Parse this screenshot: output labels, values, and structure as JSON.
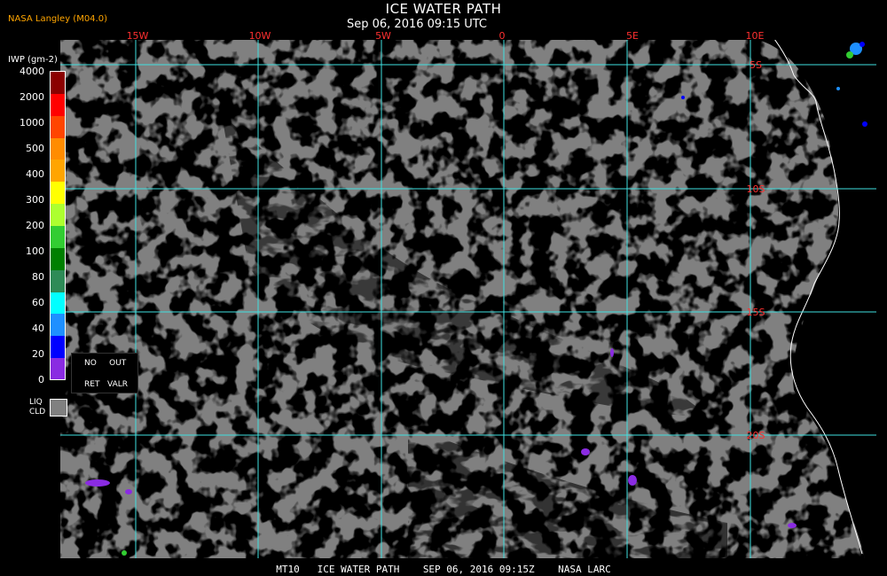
{
  "header": {
    "title": "ICE WATER PATH",
    "subtitle": "Sep 06, 2016 09:15 UTC",
    "credit": "NASA Langley (M04.0)"
  },
  "legend": {
    "label": "IWP (gm-2)",
    "ticks": [
      "4000",
      "2000",
      "1000",
      "500",
      "400",
      "300",
      "200",
      "100",
      "80",
      "60",
      "40",
      "20",
      "0"
    ],
    "colors": [
      "#8b0000",
      "#ff0000",
      "#ff4500",
      "#ff8c00",
      "#ffa500",
      "#ffff00",
      "#adff2f",
      "#32cd32",
      "#008000",
      "#2e8b57",
      "#00ffff",
      "#1e90ff",
      "#0000ff",
      "#8a2be2"
    ],
    "no_out": "NO     OUT",
    "ret_valr": "RET   VALR",
    "liq_cld": [
      "LIQ",
      "CLD"
    ],
    "liq_color": "#808080"
  },
  "map": {
    "lon_labels": [
      "15W",
      "10W",
      "5W",
      "0",
      "5E",
      "10E"
    ],
    "lat_labels": [
      "5S",
      "10S",
      "15S",
      "20S"
    ],
    "grid_color": "#40e0e0",
    "cloud_color": "#808080",
    "clear_color": "#000000",
    "coast_color": "#ffffff",
    "label_color": "#ff3030"
  },
  "footer": {
    "text": "MT10   ICE WATER PATH    SEP 06, 2016 09:15Z    NASA LARC"
  }
}
